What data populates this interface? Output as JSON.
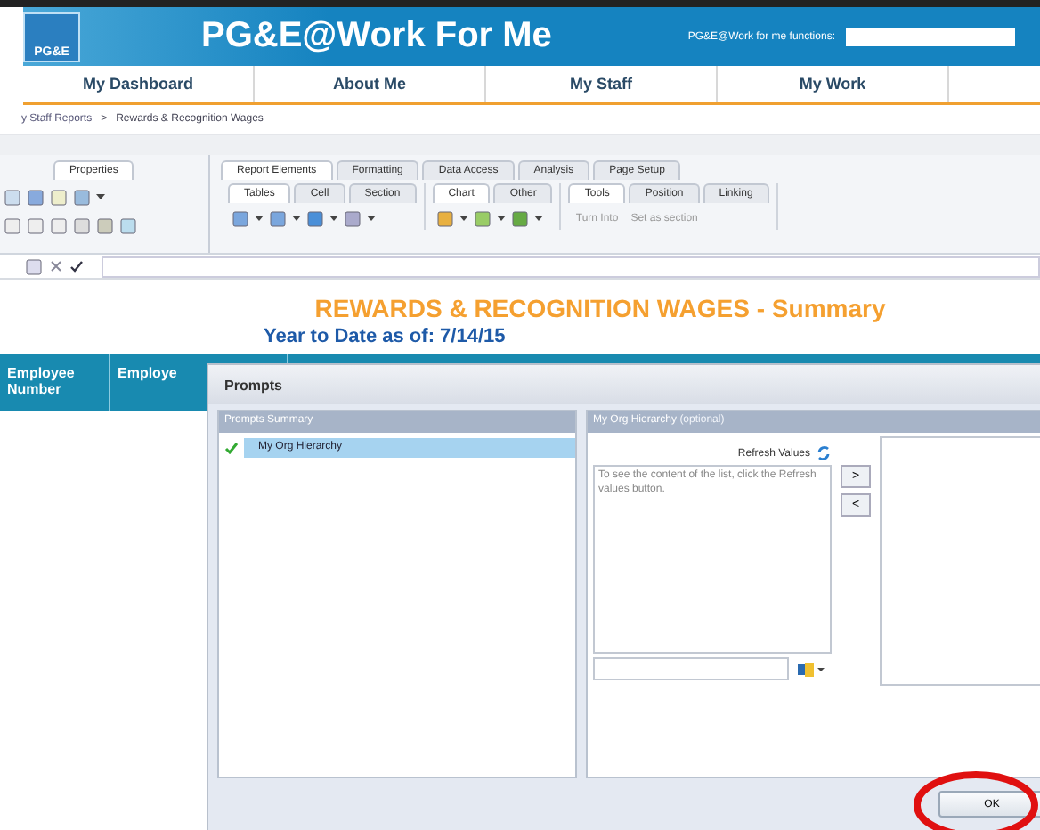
{
  "header": {
    "logo_text": "PG&E",
    "title": "PG&E@Work For Me",
    "functions_label": "PG&E@Work for me functions:"
  },
  "nav": [
    {
      "label": "My Dashboard"
    },
    {
      "label": "About Me"
    },
    {
      "label": "My Staff"
    },
    {
      "label": "My Work"
    }
  ],
  "breadcrumb": {
    "items": [
      "y Staff Reports",
      "Rewards & Recognition Wages"
    ],
    "separator": ">"
  },
  "left_panel": {
    "tab": "Properties"
  },
  "ribbon": {
    "tabs": [
      {
        "label": "Report Elements",
        "selected": true
      },
      {
        "label": "Formatting",
        "selected": false
      },
      {
        "label": "Data Access",
        "selected": false
      },
      {
        "label": "Analysis",
        "selected": false
      },
      {
        "label": "Page Setup",
        "selected": false
      }
    ],
    "groups": [
      {
        "tabs": [
          {
            "label": "Tables",
            "selected": true
          },
          {
            "label": "Cell",
            "selected": false
          },
          {
            "label": "Section",
            "selected": false
          }
        ]
      },
      {
        "tabs": [
          {
            "label": "Chart",
            "selected": true
          },
          {
            "label": "Other",
            "selected": false
          }
        ]
      },
      {
        "tabs": [
          {
            "label": "Tools",
            "selected": true
          },
          {
            "label": "Position",
            "selected": false
          },
          {
            "label": "Linking",
            "selected": false
          }
        ]
      }
    ],
    "tool_buttons": [
      {
        "label": "Turn Into",
        "disabled": true
      },
      {
        "label": "Set as section",
        "disabled": true
      }
    ]
  },
  "report": {
    "title": "REWARDS & RECOGNITION WAGES - Summary",
    "subtitle": "Year to Date as of: 7/14/15",
    "columns": [
      "Employee Number",
      "Employe"
    ]
  },
  "dialog": {
    "title": "Prompts",
    "summary_header": "Prompts Summary",
    "prompts": [
      {
        "label": "My Org Hierarchy",
        "answered": true,
        "selected": true
      }
    ],
    "detail_header": "My Org Hierarchy",
    "detail_note": "(optional)",
    "refresh_label": "Refresh Values",
    "list_hint": "To see the content of the list, click the Refresh values button.",
    "move_buttons": [
      ">",
      "<"
    ],
    "ok_label": "OK"
  },
  "annotation": {
    "kind": "ellipse"
  }
}
